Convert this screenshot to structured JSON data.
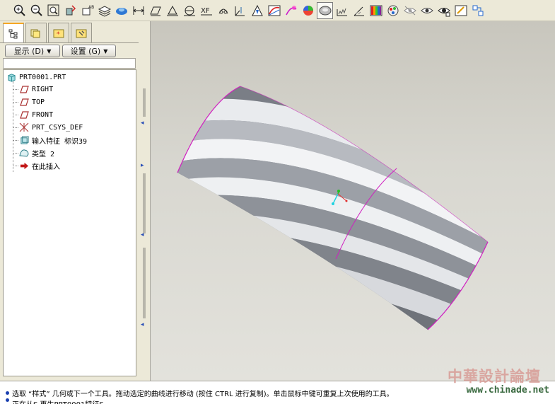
{
  "toolbar": {
    "icons": [
      "zoom-in-icon",
      "zoom-out-icon",
      "refit-icon",
      "reorient-icon",
      "saved-views-icon",
      "layers-icon",
      "model-display-icon",
      "dimension-icon",
      "datum-plane-icon",
      "datum-axis-icon",
      "datum-curve-icon",
      "sketch-icon",
      "datum-point-icon",
      "csys-icon",
      "analysis-icon",
      "curvature-icon",
      "reflection-icon",
      "shade-icon",
      "isoline-icon",
      "draft-icon",
      "dihedral-icon",
      "color-map-icon",
      "appearance-icon",
      "hide-icon",
      "show-icon",
      "eye-icon",
      "edit-icon",
      "options-icon"
    ],
    "active_index": 19
  },
  "tabs": [
    "model-tree-tab",
    "layer-tab",
    "favorites-tab",
    "settings-tab"
  ],
  "menus": {
    "show_label": "显示 (D)",
    "settings_label": "设置 (G)"
  },
  "tree": {
    "root": "PRT0001.PRT",
    "items": [
      {
        "label": "RIGHT",
        "icon": "datum-plane-icon"
      },
      {
        "label": "TOP",
        "icon": "datum-plane-icon"
      },
      {
        "label": "FRONT",
        "icon": "datum-plane-icon"
      },
      {
        "label": "PRT_CSYS_DEF",
        "icon": "csys-icon"
      },
      {
        "label": "输入特征 标识39",
        "icon": "import-feature-icon"
      },
      {
        "label": "类型 2",
        "icon": "style-feature-icon"
      },
      {
        "label": "在此插入",
        "icon": "insert-here-icon"
      }
    ]
  },
  "status": {
    "line1": "选取 “样式” 几何或下一个工具。拖动选定的曲线进行移动 (按住 CTRL 进行复制)。单击鼠标中键可重复上次使用的工具。",
    "line2": "正在从S 再生PRT0001特征S"
  },
  "watermark": {
    "title": "中華設計論壇",
    "url": "www.chinade.net"
  },
  "colors": {
    "accent": "#1a3fb0",
    "surface_edge": "#d020c0",
    "tab_highlight": "#f5a623"
  }
}
